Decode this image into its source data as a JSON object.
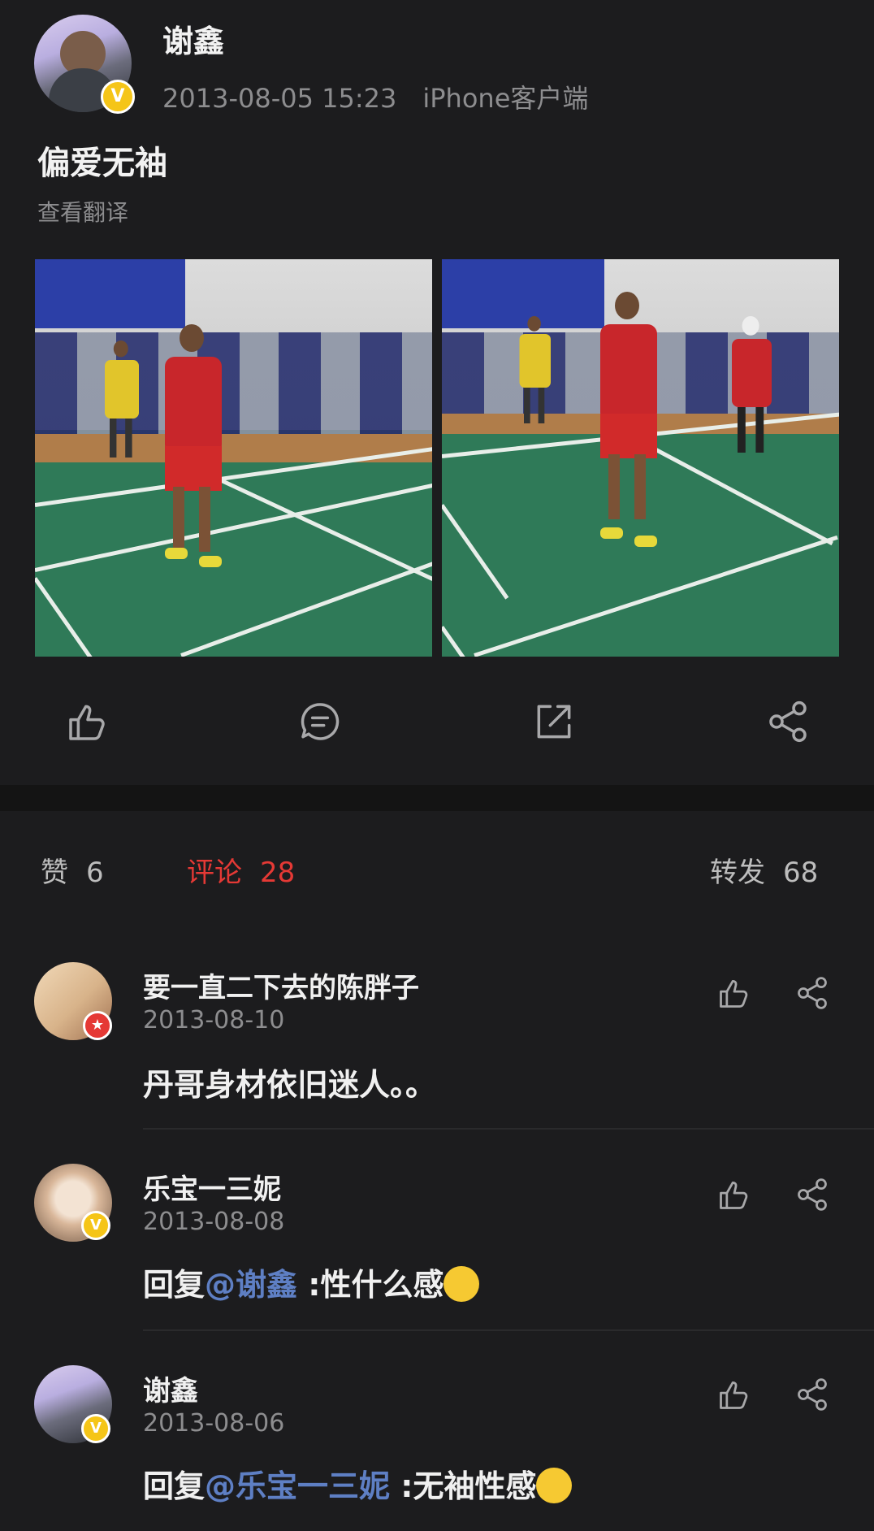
{
  "post": {
    "author": "谢鑫",
    "timestamp": "2013-08-05 15:23",
    "client": "iPhone客户端",
    "text": "偏爱无袖",
    "translate_label": "查看翻译",
    "verified_badge": "V",
    "images": [
      {
        "description_icon": "photo-badminton-player-left"
      },
      {
        "description_icon": "photo-badminton-player-right"
      }
    ]
  },
  "actions": {
    "like_icon": "thumbs-up-icon",
    "comment_icon": "comment-bubble-icon",
    "repost_icon": "external-link-icon",
    "share_icon": "share-icon"
  },
  "tabs": {
    "likes_label": "赞",
    "likes_count": "6",
    "comments_label": "评论",
    "comments_count": "28",
    "reposts_label": "转发",
    "reposts_count": "68"
  },
  "comments": [
    {
      "name": "要一直二下去的陈胖子",
      "date": "2013-08-10",
      "text": "丹哥身材依旧迷人。。",
      "badge": "★"
    },
    {
      "name": "乐宝一三妮",
      "date": "2013-08-08",
      "reply_prefix": "回复",
      "mention": "@谢鑫",
      "text": " :性什么感",
      "badge": "V"
    },
    {
      "name": "谢鑫",
      "date": "2013-08-06",
      "reply_prefix": "回复",
      "mention": "@乐宝一三妮",
      "text": " :无袖性感",
      "badge": "V"
    }
  ],
  "colors": {
    "background": "#1c1c1e",
    "accent_red": "#e53935",
    "mention_blue": "#5e7fc4",
    "verified_gold": "#f5c518"
  }
}
